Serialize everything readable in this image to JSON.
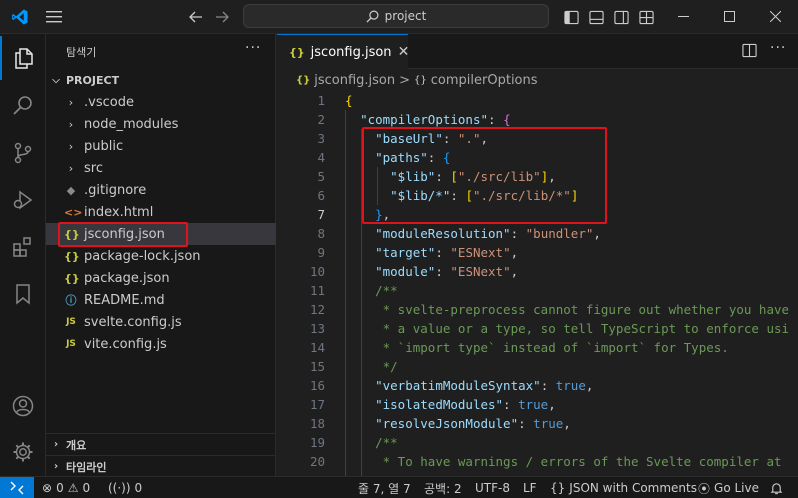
{
  "titlebar": {
    "search_text": "project"
  },
  "sidebar": {
    "title": "탐색기",
    "more": "···",
    "root": "PROJECT",
    "items": [
      {
        "label": ".vscode",
        "kind": "folder"
      },
      {
        "label": "node_modules",
        "kind": "folder"
      },
      {
        "label": "public",
        "kind": "folder"
      },
      {
        "label": "src",
        "kind": "folder"
      },
      {
        "label": ".gitignore",
        "kind": "git",
        "icon": "◆"
      },
      {
        "label": "index.html",
        "kind": "html",
        "icon": "<>"
      },
      {
        "label": "jsconfig.json",
        "kind": "json",
        "icon": "{}"
      },
      {
        "label": "package-lock.json",
        "kind": "json",
        "icon": "{}"
      },
      {
        "label": "package.json",
        "kind": "json",
        "icon": "{}"
      },
      {
        "label": "README.md",
        "kind": "info",
        "icon": "ⓘ"
      },
      {
        "label": "svelte.config.js",
        "kind": "js",
        "icon": "JS"
      },
      {
        "label": "vite.config.js",
        "kind": "js",
        "icon": "JS"
      }
    ],
    "outline_label": "개요",
    "timeline_label": "타임라인"
  },
  "editor": {
    "tab_label": "jsconfig.json",
    "tab_icon": "{}",
    "breadcrumb": {
      "file": "jsconfig.json",
      "symbol": "compilerOptions",
      "separator": ">"
    },
    "line_numbers": [
      "1",
      "2",
      "3",
      "4",
      "5",
      "6",
      "7",
      "8",
      "9",
      "10",
      "11",
      "12",
      "13",
      "14",
      "15",
      "16",
      "17",
      "18",
      "19",
      "20"
    ],
    "current_line": "7"
  },
  "statusbar": {
    "problems_errors": "0",
    "problems_warnings": "0",
    "ports": "0",
    "cursor": "줄 7, 열 7",
    "indent": "공백: 2",
    "encoding": "UTF-8",
    "eol": "LF",
    "language": "JSON with Comments",
    "golive": "Go Live"
  },
  "colors": {
    "accent": "#0078d4",
    "highlight_box": "#e0121b",
    "json_key": "#9cdcfe",
    "json_string": "#ce9178",
    "comment": "#6a9955"
  }
}
